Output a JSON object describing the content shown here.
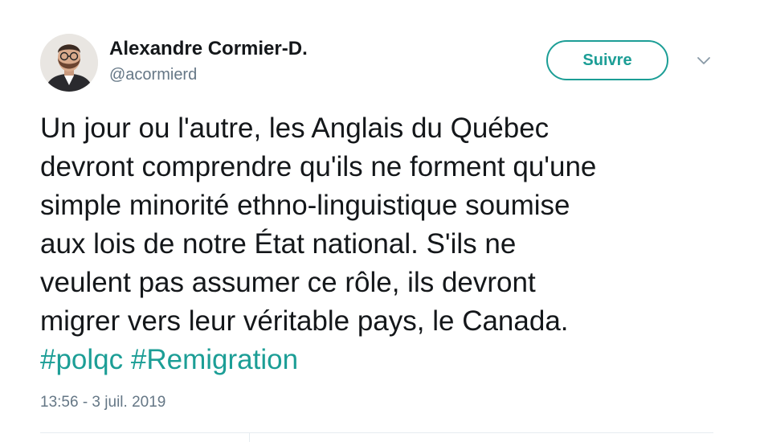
{
  "author": {
    "display_name": "Alexandre Cormier-D.",
    "handle": "@acormierd",
    "avatar_icon": "avatar-photo"
  },
  "follow_button": {
    "label": "Suivre",
    "color": "#1c9e96"
  },
  "menu_icon": "chevron-down-icon",
  "tweet": {
    "lines": [
      "Un jour ou l'autre, les Anglais du Québec",
      "devront comprendre qu'ils ne forment qu'une",
      "simple minorité ethno-linguistique soumise",
      "aux lois de notre État national. S'ils ne",
      "veulent pas assumer ce rôle, ils devront",
      "migrer vers leur véritable pays, le Canada."
    ],
    "hashtags": [
      "#polqc",
      "#Remigration"
    ],
    "hashtag_color": "#1c9e96",
    "timestamp": "13:56 - 3 juil. 2019"
  }
}
